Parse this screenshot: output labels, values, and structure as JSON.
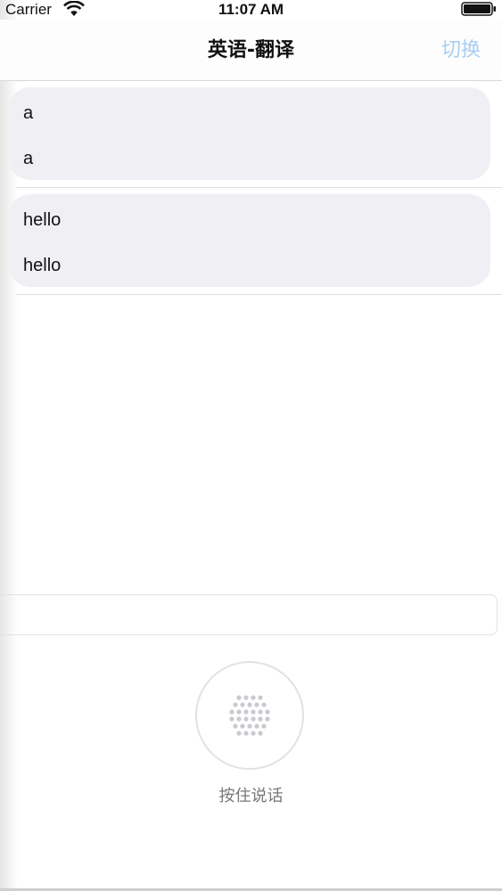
{
  "status_bar": {
    "carrier": "Carrier",
    "time": "11:07 AM"
  },
  "nav": {
    "title": "英语-翻译",
    "switch_label": "切换"
  },
  "messages": [
    {
      "source": "a",
      "translation": "a"
    },
    {
      "source": "hello",
      "translation": "hello"
    }
  ],
  "voice": {
    "hint": "按住说话"
  },
  "colors": {
    "accent_disabled": "#a9cdf2",
    "bubble": "#efeff4"
  },
  "icons": {
    "wifi": "wifi-icon",
    "battery": "battery-icon",
    "mic": "dotted-mic-icon"
  }
}
